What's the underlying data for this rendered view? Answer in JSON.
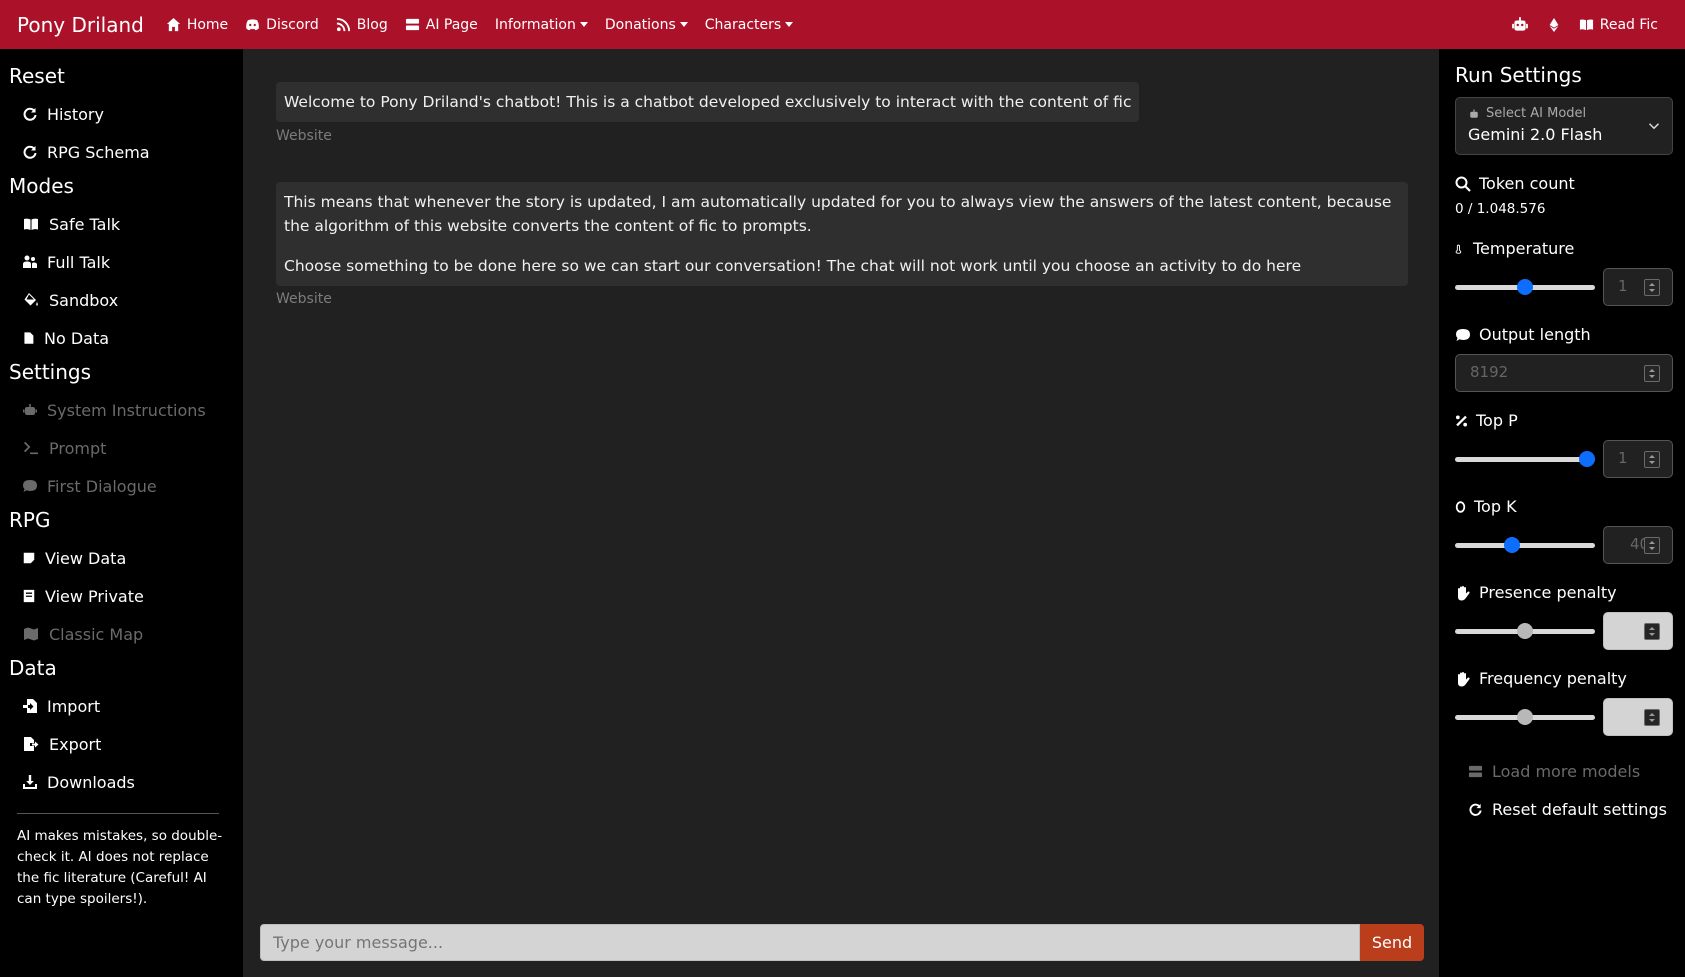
{
  "navbar": {
    "brand": "Pony Driland",
    "items": [
      {
        "label": "Home",
        "icon": "home-icon"
      },
      {
        "label": "Discord",
        "icon": "discord-icon"
      },
      {
        "label": "Blog",
        "icon": "rss-icon"
      },
      {
        "label": "AI Page",
        "icon": "server-icon"
      },
      {
        "label": "Information",
        "dropdown": true
      },
      {
        "label": "Donations",
        "dropdown": true
      },
      {
        "label": "Characters",
        "dropdown": true
      }
    ],
    "right": {
      "read_fic": "Read Fic"
    }
  },
  "sidebar": {
    "reset": {
      "title": "Reset",
      "items": [
        "History",
        "RPG Schema"
      ]
    },
    "modes": {
      "title": "Modes",
      "items": [
        "Safe Talk",
        "Full Talk",
        "Sandbox",
        "No Data"
      ]
    },
    "settings": {
      "title": "Settings",
      "items": [
        "System Instructions",
        "Prompt",
        "First Dialogue"
      ]
    },
    "rpg": {
      "title": "RPG",
      "items": [
        "View Data",
        "View Private",
        "Classic Map"
      ]
    },
    "data": {
      "title": "Data",
      "items": [
        "Import",
        "Export",
        "Downloads"
      ]
    },
    "note": "AI makes mistakes, so double-check it. AI does not replace the fic literature (Careful! AI can type spoilers!)."
  },
  "chat": {
    "messages": [
      {
        "paragraphs": [
          "Welcome to Pony Driland's chatbot! This is a chatbot developed exclusively to interact with the content of fic"
        ],
        "source": "Website"
      },
      {
        "paragraphs": [
          "This means that whenever the story is updated, I am automatically updated for you to always view the answers of the latest content, because the algorithm of this website converts the content of fic to prompts.",
          "Choose something to be done here so we can start our conversation! The chat will not work until you choose an activity to do here"
        ],
        "source": "Website"
      }
    ],
    "input_placeholder": "Type your message...",
    "send_label": "Send"
  },
  "run_settings": {
    "title": "Run Settings",
    "model_label": "Select AI Model",
    "model_value": "Gemini 2.0 Flash",
    "token_count_label": "Token count",
    "token_count_value": "0 / 1.048.576",
    "temperature": {
      "label": "Temperature",
      "value": "1",
      "slider_fraction": 0.5
    },
    "output_length": {
      "label": "Output length",
      "value": "8192"
    },
    "top_p": {
      "label": "Top P",
      "value": "1",
      "slider_fraction": 0.94
    },
    "top_k": {
      "label": "Top K",
      "value": "40",
      "slider_fraction": 0.41
    },
    "presence_penalty": {
      "label": "Presence penalty",
      "value": "",
      "slider_fraction": 0.5
    },
    "frequency_penalty": {
      "label": "Frequency penalty",
      "value": "",
      "slider_fraction": 0.5
    },
    "load_more": "Load more models",
    "reset_default": "Reset default settings"
  },
  "colors": {
    "navbar": "#ab1229",
    "send_button": "#ba3d1c",
    "slider_thumb": "#0d6efd"
  }
}
